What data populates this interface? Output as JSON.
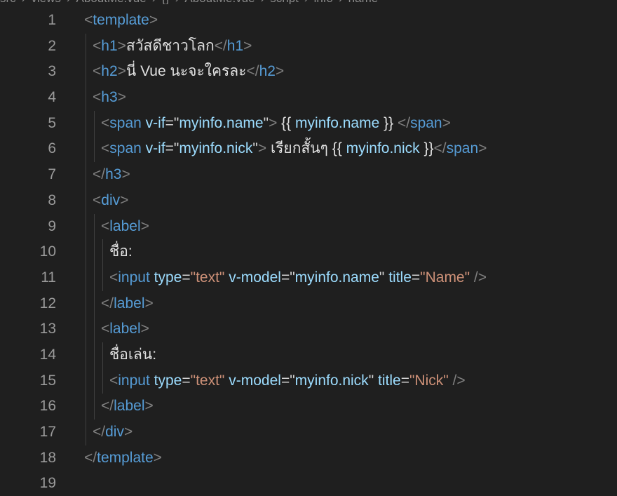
{
  "breadcrumb": {
    "items": [
      "src",
      "views",
      "AboutMe.vue",
      "{}",
      "AboutMe.vue",
      "script",
      "info",
      "name"
    ]
  },
  "editor": {
    "lines": [
      {
        "num": "1",
        "indent": 0,
        "tokens": [
          [
            "p",
            "<"
          ],
          [
            "t",
            "template"
          ],
          [
            "p",
            ">"
          ]
        ]
      },
      {
        "num": "2",
        "indent": 1,
        "tokens": [
          [
            "p",
            "<"
          ],
          [
            "t",
            "h1"
          ],
          [
            "p",
            ">"
          ],
          [
            "x",
            "สวัสดีชาวโลก"
          ],
          [
            "p",
            "</"
          ],
          [
            "t",
            "h1"
          ],
          [
            "p",
            ">"
          ]
        ]
      },
      {
        "num": "3",
        "indent": 1,
        "tokens": [
          [
            "p",
            "<"
          ],
          [
            "t",
            "h2"
          ],
          [
            "p",
            ">"
          ],
          [
            "x",
            "นี่ Vue นะจะใครละ"
          ],
          [
            "p",
            "</"
          ],
          [
            "t",
            "h2"
          ],
          [
            "p",
            ">"
          ]
        ]
      },
      {
        "num": "4",
        "indent": 1,
        "tokens": [
          [
            "p",
            "<"
          ],
          [
            "t",
            "h3"
          ],
          [
            "p",
            ">"
          ]
        ]
      },
      {
        "num": "5",
        "indent": 2,
        "tokens": [
          [
            "p",
            "<"
          ],
          [
            "t",
            "span"
          ],
          [
            "x",
            " "
          ],
          [
            "a",
            "v-if"
          ],
          [
            "q",
            "=\""
          ],
          [
            "i",
            "myinfo.name"
          ],
          [
            "q",
            "\""
          ],
          [
            "p",
            ">"
          ],
          [
            "x",
            " {{ "
          ],
          [
            "i",
            "myinfo.name"
          ],
          [
            "x",
            " }} "
          ],
          [
            "p",
            "</"
          ],
          [
            "t",
            "span"
          ],
          [
            "p",
            ">"
          ]
        ]
      },
      {
        "num": "6",
        "indent": 2,
        "tokens": [
          [
            "p",
            "<"
          ],
          [
            "t",
            "span"
          ],
          [
            "x",
            " "
          ],
          [
            "a",
            "v-if"
          ],
          [
            "q",
            "=\""
          ],
          [
            "i",
            "myinfo.nick"
          ],
          [
            "q",
            "\""
          ],
          [
            "p",
            ">"
          ],
          [
            "x",
            " เรียกสั้นๆ {{ "
          ],
          [
            "i",
            "myinfo.nick"
          ],
          [
            "x",
            " }}"
          ],
          [
            "p",
            "</"
          ],
          [
            "t",
            "span"
          ],
          [
            "p",
            ">"
          ]
        ]
      },
      {
        "num": "7",
        "indent": 1,
        "tokens": [
          [
            "p",
            "</"
          ],
          [
            "t",
            "h3"
          ],
          [
            "p",
            ">"
          ]
        ]
      },
      {
        "num": "8",
        "indent": 1,
        "tokens": [
          [
            "p",
            "<"
          ],
          [
            "t",
            "div"
          ],
          [
            "p",
            ">"
          ]
        ]
      },
      {
        "num": "9",
        "indent": 2,
        "tokens": [
          [
            "p",
            "<"
          ],
          [
            "t",
            "label"
          ],
          [
            "p",
            ">"
          ]
        ]
      },
      {
        "num": "10",
        "indent": 3,
        "tokens": [
          [
            "x",
            "ชื่อ:"
          ]
        ]
      },
      {
        "num": "11",
        "indent": 3,
        "tokens": [
          [
            "p",
            "<"
          ],
          [
            "t",
            "input"
          ],
          [
            "x",
            " "
          ],
          [
            "a",
            "type"
          ],
          [
            "q",
            "="
          ],
          [
            "s",
            "\"text\""
          ],
          [
            "x",
            " "
          ],
          [
            "a",
            "v-model"
          ],
          [
            "q",
            "=\""
          ],
          [
            "i",
            "myinfo.name"
          ],
          [
            "q",
            "\""
          ],
          [
            "x",
            " "
          ],
          [
            "a",
            "title"
          ],
          [
            "q",
            "="
          ],
          [
            "s",
            "\"Name\""
          ],
          [
            "x",
            " "
          ],
          [
            "p",
            "/>"
          ]
        ]
      },
      {
        "num": "12",
        "indent": 2,
        "tokens": [
          [
            "p",
            "</"
          ],
          [
            "t",
            "label"
          ],
          [
            "p",
            ">"
          ]
        ]
      },
      {
        "num": "13",
        "indent": 2,
        "tokens": [
          [
            "p",
            "<"
          ],
          [
            "t",
            "label"
          ],
          [
            "p",
            ">"
          ]
        ]
      },
      {
        "num": "14",
        "indent": 3,
        "tokens": [
          [
            "x",
            "ชื่อเล่น:"
          ]
        ]
      },
      {
        "num": "15",
        "indent": 3,
        "tokens": [
          [
            "p",
            "<"
          ],
          [
            "t",
            "input"
          ],
          [
            "x",
            " "
          ],
          [
            "a",
            "type"
          ],
          [
            "q",
            "="
          ],
          [
            "s",
            "\"text\""
          ],
          [
            "x",
            " "
          ],
          [
            "a",
            "v-model"
          ],
          [
            "q",
            "=\""
          ],
          [
            "i",
            "myinfo.nick"
          ],
          [
            "q",
            "\""
          ],
          [
            "x",
            " "
          ],
          [
            "a",
            "title"
          ],
          [
            "q",
            "="
          ],
          [
            "s",
            "\"Nick\""
          ],
          [
            "x",
            " "
          ],
          [
            "p",
            "/>"
          ]
        ]
      },
      {
        "num": "16",
        "indent": 2,
        "tokens": [
          [
            "p",
            "</"
          ],
          [
            "t",
            "label"
          ],
          [
            "p",
            ">"
          ]
        ]
      },
      {
        "num": "17",
        "indent": 1,
        "tokens": [
          [
            "p",
            "</"
          ],
          [
            "t",
            "div"
          ],
          [
            "p",
            ">"
          ]
        ]
      },
      {
        "num": "18",
        "indent": 0,
        "tokens": [
          [
            "p",
            "</"
          ],
          [
            "t",
            "template"
          ],
          [
            "p",
            ">"
          ]
        ]
      },
      {
        "num": "19",
        "indent": 0,
        "tokens": []
      }
    ]
  },
  "colors": {
    "background": "#1f1f1f",
    "line_number": "#9a9a9a",
    "tag": "#569cd6",
    "attribute": "#9cdcfe",
    "string": "#ce9178",
    "punctuation": "#808080",
    "text": "#e0e0e0"
  }
}
